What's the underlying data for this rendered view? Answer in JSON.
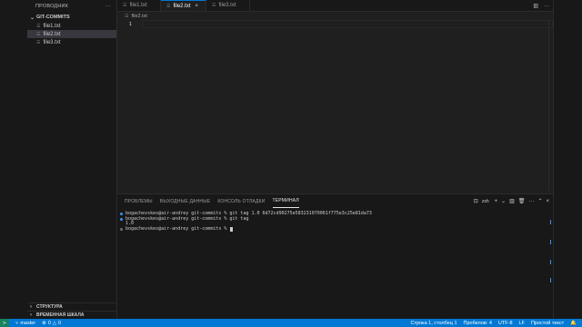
{
  "sidebar": {
    "title": "ПРОВОДНИК",
    "more_icon": "ellipsis-icon",
    "folder": "GIT-COMMITS",
    "files": [
      {
        "name": "file1.txt",
        "icon": "file-text-icon"
      },
      {
        "name": "file2.txt",
        "icon": "file-text-icon"
      },
      {
        "name": "file3.txt",
        "icon": "file-text-icon"
      }
    ],
    "bottom_sections": [
      "СТРУКТУРА",
      "ВРЕМЕННАЯ ШКАЛА"
    ]
  },
  "editor": {
    "tabs": [
      {
        "label": "file1.txt"
      },
      {
        "label": "file2.txt"
      },
      {
        "label": "file3.txt"
      }
    ],
    "breadcrumb": "file2.txt",
    "line_number": "1"
  },
  "panel": {
    "tabs": [
      "ПРОБЛЕМЫ",
      "ВЫХОДНЫЕ ДАННЫЕ",
      "КОНСОЛЬ ОТЛАДКИ",
      "ТЕРМИНАЛ"
    ],
    "shell": "zsh",
    "terminal_lines": [
      "bogachevskes@air-andrey git-commits % git tag 1.0 6d72cd90275e583231070061f775e3c25e81da73",
      "bogachevskes@air-andrey git-commits % git tag",
      "1.0",
      "bogachevskes@air-andrey git-commits % "
    ]
  },
  "statusbar": {
    "branch": "master",
    "errors": "0",
    "warnings": "0",
    "position": "Строка 1, столбец 1",
    "spaces": "Пробелов: 4",
    "encoding": "UTF-8",
    "eol": "LF",
    "language": "Простой текст"
  },
  "colors": {
    "accent": "#0078d4",
    "remote": "#16825d",
    "terminal_dot": "#3794ff"
  }
}
